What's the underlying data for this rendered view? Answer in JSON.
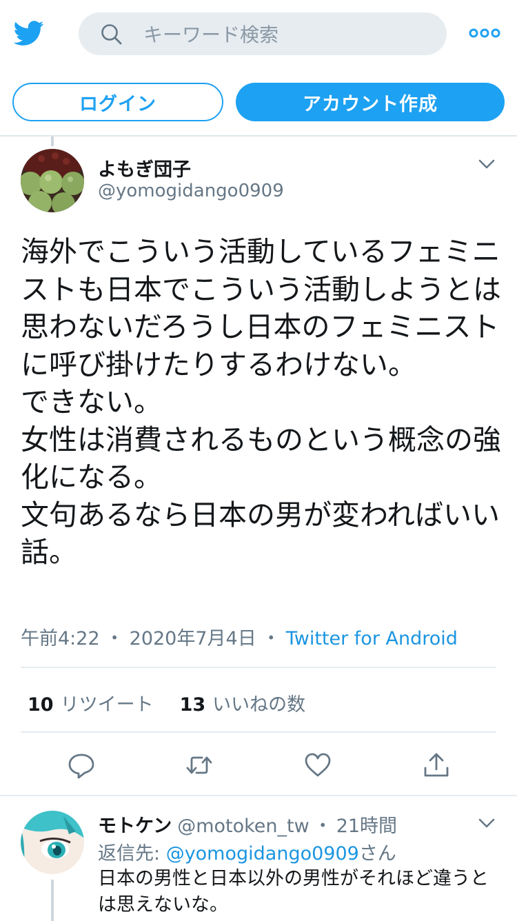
{
  "header": {
    "search_placeholder": "キーワード検索"
  },
  "auth": {
    "login_label": "ログイン",
    "signup_label": "アカウント作成"
  },
  "tweet": {
    "author_name": "よもぎ団子",
    "author_handle": "@yomogidango0909",
    "text": "海外でこういう活動しているフェミニストも日本でこういう活動しようとは思わないだろうし日本のフェミニストに呼び掛けたりするわけない。\nできない。\n女性は消費されるものという概念の強化になる。\n文句あるなら日本の男が変わればいい話。",
    "time": "午前4:22",
    "date": "2020年7月4日",
    "source": "Twitter for Android",
    "separator": "・",
    "retweet_count": "10",
    "retweet_label": "リツイート",
    "like_count": "13",
    "like_label": "いいねの数"
  },
  "reply": {
    "author_name": "モトケン",
    "author_handle": "@motoken_tw",
    "separator": "・",
    "time": "21時間",
    "reply_to_prefix": "返信先: ",
    "reply_to_handle": "@yomogidango0909",
    "reply_to_suffix": "さん",
    "text": "日本の男性と日本以外の男性がそれほど違うとは思えないな。"
  },
  "colors": {
    "accent": "#1da1f2",
    "link": "#1b95e0",
    "secondary_text": "#657786",
    "search_bg": "#e6ecf0"
  },
  "icons": [
    "twitter-bird-icon",
    "search-icon",
    "more-icon",
    "chevron-down-icon",
    "reply-icon",
    "retweet-icon",
    "like-icon",
    "share-icon"
  ]
}
